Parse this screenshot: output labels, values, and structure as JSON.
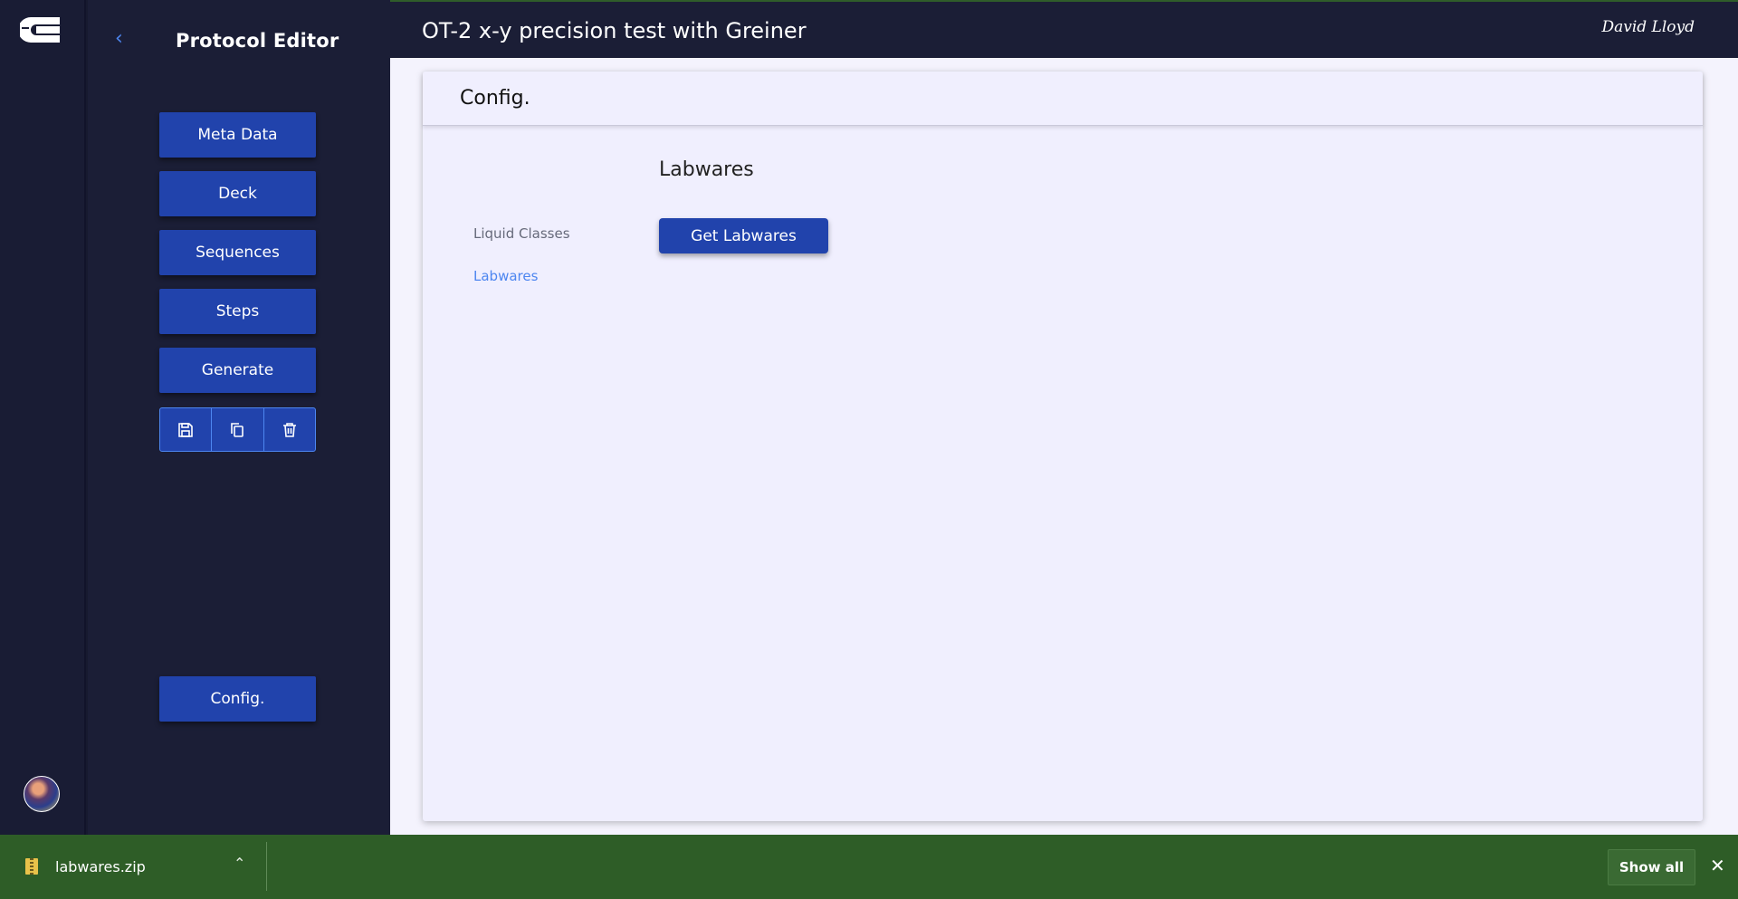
{
  "app": {
    "logo_icon": "app-logo-icon",
    "avatar_icon": "user-avatar"
  },
  "sidebar": {
    "back_icon": "chevron-left-icon",
    "title": "Protocol Editor",
    "nav": [
      {
        "label": "Meta Data"
      },
      {
        "label": "Deck"
      },
      {
        "label": "Sequences"
      },
      {
        "label": "Steps"
      },
      {
        "label": "Generate"
      }
    ],
    "actions": [
      "save-icon",
      "copy-icon",
      "trash-icon"
    ],
    "config_label": "Config."
  },
  "header": {
    "protocol_title": "OT-2 x-y precision test with Greiner",
    "signature": "David Lloyd"
  },
  "card": {
    "title": "Config.",
    "subnav": [
      {
        "label": "Liquid Classes",
        "active": false
      },
      {
        "label": "Labwares",
        "active": true
      }
    ],
    "section_title": "Labwares",
    "get_button": "Get Labwares"
  },
  "download_bar": {
    "file_name": "labwares.zip",
    "show_all": "Show all",
    "close_icon": "close-icon"
  },
  "colors": {
    "accent": "#2143ac",
    "link": "#4d86f0",
    "dark_bg": "#1b1e36",
    "download_bar": "#2e5d27"
  }
}
